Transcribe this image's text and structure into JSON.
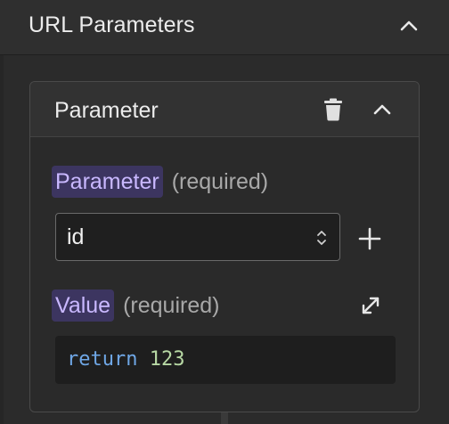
{
  "section": {
    "title": "URL Parameters"
  },
  "parameter_card": {
    "title": "Parameter",
    "parameter_field": {
      "label": "Parameter",
      "required": "(required)",
      "value": "id"
    },
    "value_field": {
      "label": "Value",
      "required": "(required)",
      "code_keyword": "return",
      "code_value": "123"
    }
  },
  "icons": {
    "collapse": "chevron-up-icon",
    "delete": "trash-icon",
    "add": "plus-icon",
    "expand": "expand-icon",
    "select": "updown-chevron-icon"
  },
  "colors": {
    "label_highlight_bg": "#3c3560",
    "label_highlight_text": "#c9b8ff",
    "code_keyword": "#6fa7e6",
    "code_number": "#b7d8a4"
  }
}
